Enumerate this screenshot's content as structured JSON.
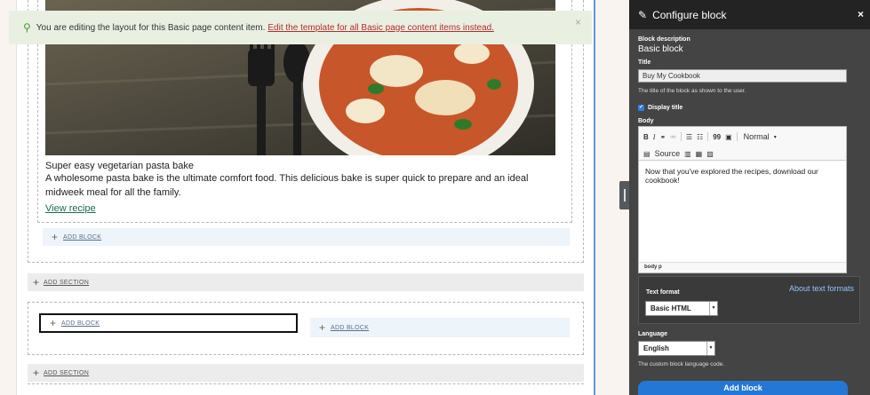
{
  "notice": {
    "text": "You are editing the layout for this Basic page content item.",
    "link": "Edit the template for all Basic page content items instead.",
    "close": "×"
  },
  "card": {
    "title": "Super easy vegetarian pasta bake",
    "body": "A wholesome pasta bake is the ultimate comfort food. This delicious bake is super quick to prepare and an ideal midweek meal for all the family.",
    "link": "View recipe"
  },
  "layout": {
    "add_block": "ADD BLOCK",
    "add_section": "ADD SECTION",
    "plus": "+"
  },
  "panel": {
    "header_title": "Configure block",
    "close": "×",
    "block_description_label": "Block description",
    "block_description_value": "Basic block",
    "title_label": "Title",
    "title_value": "Buy My Cookbook",
    "title_help": "The title of the block as shown to the user.",
    "display_title_label": "Display title",
    "body_label": "Body",
    "editor": {
      "bold": "B",
      "italic": "I",
      "quote": "99",
      "format_select": "Normal",
      "source": "Source",
      "content": "Now that you've explored the recipes, download our cookbook!",
      "path": "body  p"
    },
    "text_format_label": "Text format",
    "text_format_value": "Basic HTML",
    "about_formats": "About text formats",
    "language_label": "Language",
    "language_value": "English",
    "language_help": "The custom block language code.",
    "submit": "Add block"
  },
  "colors": {
    "panel_bg": "#444444",
    "accent_blue": "#2477d4",
    "notice_bg": "#e9f0e2",
    "link_green": "#1d6b4d",
    "link_red": "#b42b2b"
  }
}
